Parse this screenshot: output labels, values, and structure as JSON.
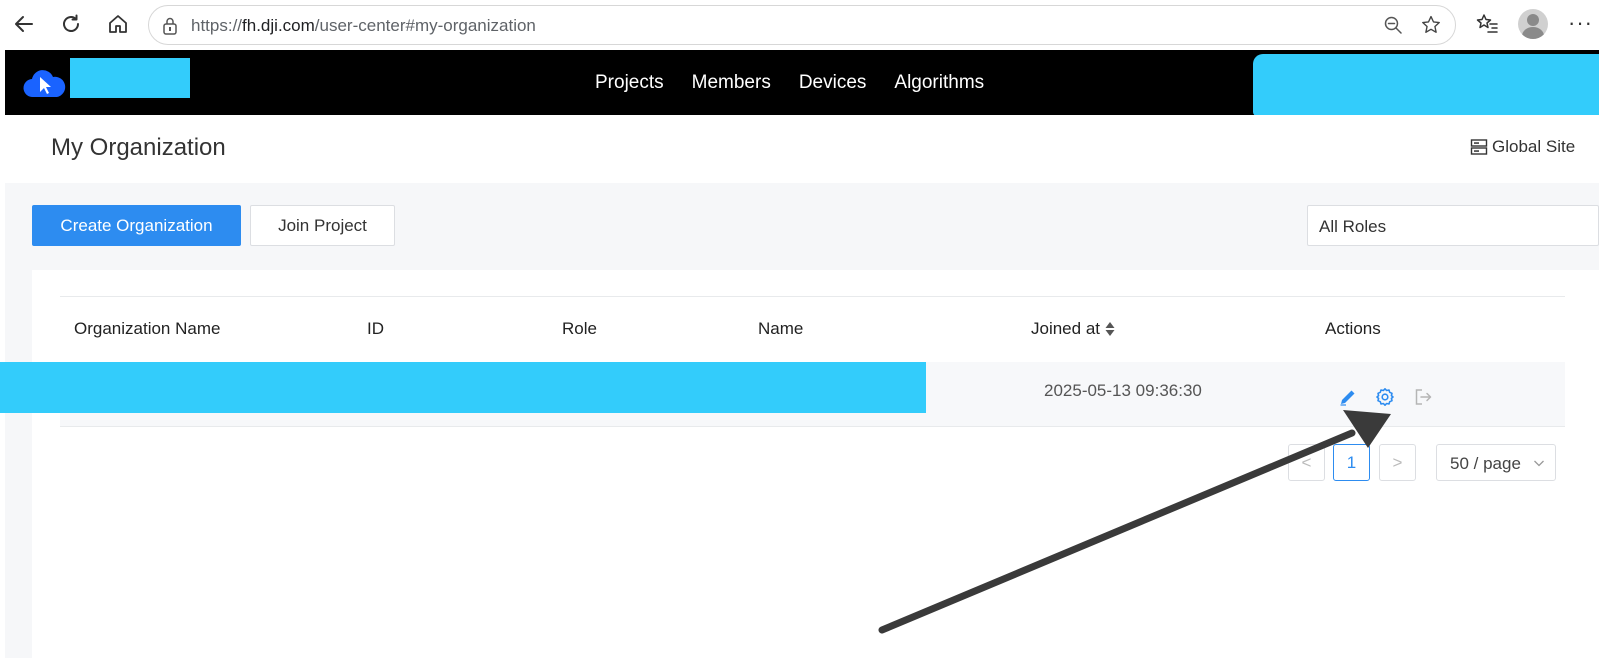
{
  "browser": {
    "url_prefix": "https://",
    "url_domain": "fh.dji.com",
    "url_path": "/user-center#my-organization"
  },
  "app": {
    "nav": [
      "Projects",
      "Members",
      "Devices",
      "Algorithms"
    ]
  },
  "page": {
    "title": "My Organization",
    "global_site": "Global Site"
  },
  "toolbar": {
    "create_label": "Create Organization",
    "join_label": "Join Project",
    "role_filter": "All Roles"
  },
  "table": {
    "columns": [
      "Organization Name",
      "ID",
      "Role",
      "Name",
      "Joined at",
      "Actions"
    ],
    "rows": [
      {
        "joined_at": "2025-05-13 09:36:30"
      }
    ]
  },
  "pagination": {
    "current_page": "1",
    "prev": "<",
    "next": ">",
    "page_size": "50 / page"
  },
  "colors": {
    "accent": "#2d8cf0",
    "redaction": "#33ccfb",
    "annotation_arrow": "#3a3a3a"
  }
}
